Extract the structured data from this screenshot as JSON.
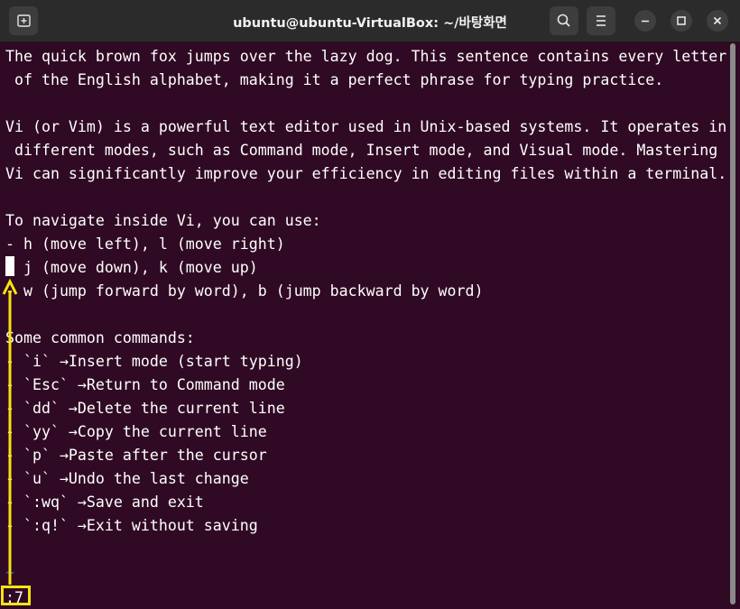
{
  "window": {
    "title": "ubuntu@ubuntu-VirtualBox: ~/바탕화면"
  },
  "titlebar": {
    "new_tab_icon": "new-tab-icon",
    "search_icon": "search-icon",
    "menu_icon": "hamburger-menu-icon",
    "minimize_icon": "minimize-icon",
    "maximize_icon": "maximize-icon",
    "close_icon": "close-icon"
  },
  "terminal": {
    "lines": [
      "The quick brown fox jumps over the lazy dog. This sentence contains every letter",
      " of the English alphabet, making it a perfect phrase for typing practice.",
      "",
      "Vi (or Vim) is a powerful text editor used in Unix-based systems. It operates in",
      " different modes, such as Command mode, Insert mode, and Visual mode. Mastering",
      "Vi can significantly improve your efficiency in editing files within a terminal.",
      "",
      "To navigate inside Vi, you can use:",
      "- h (move left), l (move right)",
      "- j (move down), k (move up)",
      "- w (jump forward by word), b (jump backward by word)",
      "",
      "Some common commands:",
      "- `i` →Insert mode (start typing)",
      "- `Esc` →Return to Command mode",
      "- `dd` →Delete the current line",
      "- `yy` →Copy the current line",
      "- `p` →Paste after the cursor",
      "- `u` →Undo the last change",
      "- `:wq` →Save and exit",
      "- `:q!` →Exit without saving",
      "",
      "~"
    ],
    "command_line": ":7"
  },
  "colors": {
    "terminal_bg": "#300a24",
    "titlebar_bg": "#2b2b2b",
    "annotation": "#f7e40f"
  }
}
